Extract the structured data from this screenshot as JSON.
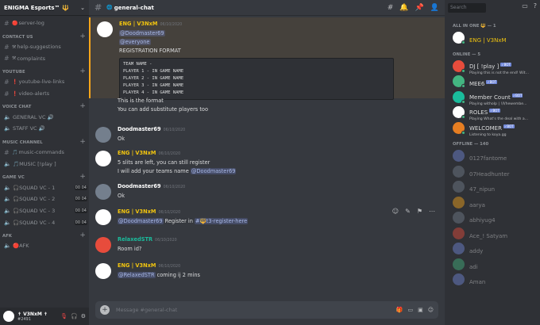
{
  "server": {
    "name": "ENIGMA Esports™ 🔱"
  },
  "sidebar": {
    "channels": [
      {
        "kind": "text",
        "emoji": "🔴",
        "label": "server-log"
      },
      {
        "kind": "cat",
        "label": "CONTACT US"
      },
      {
        "kind": "text",
        "emoji": "⚒",
        "label": "help-suggestions"
      },
      {
        "kind": "text",
        "emoji": "⚒",
        "label": "complaints"
      },
      {
        "kind": "cat",
        "label": "YOUTUBE"
      },
      {
        "kind": "text",
        "emoji": "❗",
        "label": "youtube-live-links"
      },
      {
        "kind": "text",
        "emoji": "❗",
        "label": "video-alerts"
      },
      {
        "kind": "cat",
        "label": "VOICE CHAT"
      },
      {
        "kind": "voice",
        "label": "GENERAL VC 🔊"
      },
      {
        "kind": "voice",
        "label": "STAFF VC 🔊"
      },
      {
        "kind": "cat",
        "label": "MUSIC CHANNEL"
      },
      {
        "kind": "text",
        "emoji": "🎵",
        "label": "music-commands"
      },
      {
        "kind": "voice",
        "label": "🎵MUSIC [!play ]"
      },
      {
        "kind": "cat",
        "label": "GAME VC"
      },
      {
        "kind": "voice",
        "label": "🎧SQUAD VC - 1",
        "count": "00 04"
      },
      {
        "kind": "voice",
        "label": "🎧SQUAD VC - 2",
        "count": "00 04"
      },
      {
        "kind": "voice",
        "label": "🎧SQUAD VC - 3",
        "count": "00 04"
      },
      {
        "kind": "voice",
        "label": "🎧SQUAD VC - 4",
        "count": "00 04"
      },
      {
        "kind": "cat",
        "label": "AFK"
      },
      {
        "kind": "voice",
        "label": "🔴AFK"
      }
    ]
  },
  "user": {
    "name": "✝ V3NxM ✝",
    "tag": "#2491"
  },
  "channel": {
    "name": "general-chat"
  },
  "search": {
    "placeholder": "Search"
  },
  "messages": [
    {
      "author": "ENG | V3NxM",
      "ts": "06/10/2020",
      "color": "#f1c40f",
      "av": "#ffffff",
      "highlight": true,
      "lines": [
        {
          "mention": "@Doodmaster69"
        },
        {
          "mention": "@everyone"
        },
        {
          "text": "REGISTRATION FORMAT"
        }
      ],
      "code": [
        "TEAM NAME -",
        "PLAYER 1 - IN GAME NAME",
        "PLAYER 2 - IN GAME NAME",
        "PLAYER 3 - IN GAME NAME",
        "PLAYER 4 - IN GAME NAME"
      ]
    },
    {
      "cont": true,
      "lines": [
        {
          "text": "This is the format"
        },
        {
          "text": "You can add substitute players too"
        }
      ]
    },
    {
      "author": "Doodmaster69",
      "ts": "06/10/2020",
      "color": "#ffffff",
      "av": "#747f8d",
      "lines": [
        {
          "text": "Ok"
        }
      ]
    },
    {
      "author": "ENG | V3NxM",
      "ts": "06/10/2020",
      "color": "#f1c40f",
      "av": "#ffffff",
      "lines": [
        {
          "text": "5 slits are left, you can still register"
        },
        {
          "text": "I will add your teams name ",
          "mention": "@Doodmaster69"
        }
      ]
    },
    {
      "author": "Doodmaster69",
      "ts": "06/10/2020",
      "color": "#ffffff",
      "av": "#747f8d",
      "lines": [
        {
          "text": "Ok"
        }
      ]
    },
    {
      "author": "ENG | V3NxM",
      "ts": "06/10/2020",
      "color": "#f1c40f",
      "av": "#ffffff",
      "lines": [
        {
          "mention": "@Doodmaster69",
          "text2": " Register in ",
          "mention2": "#🔱t3-register-here"
        }
      ]
    },
    {
      "author": "RelaxedSTR",
      "ts": "06/10/2020",
      "color": "#1abc9c",
      "av": "#e74c3c",
      "lines": [
        {
          "text": "Room id?"
        }
      ]
    },
    {
      "author": "ENG | V3NxM",
      "ts": "06/10/2020",
      "color": "#f1c40f",
      "av": "#ffffff",
      "lines": [
        {
          "mention": "@RelaxedSTR",
          "text2": " coming ij 2 mins"
        }
      ]
    }
  ],
  "input": {
    "placeholder": "Message #general-chat"
  },
  "members": {
    "groups": [
      {
        "label": "ALL IN ONE 🔱 — 1",
        "items": [
          {
            "name": "ENG | V3NxM",
            "color": "#f1c40f",
            "av": "#ffffff"
          }
        ]
      },
      {
        "label": "ONLINE — 5",
        "items": [
          {
            "name": "DJ [ !play ]",
            "bot": "✓BOT",
            "sub": "Playing this is not the end! Wit...",
            "color": "#dcddde",
            "av": "#e74c3c"
          },
          {
            "name": "MEE6",
            "bot": "✓BOT",
            "color": "#dcddde",
            "av": "#43b581"
          },
          {
            "name": "Member Count",
            "bot": "✓BOT",
            "sub": "Playing witholp | !/l/hewembe...",
            "color": "#dcddde",
            "av": "#1abc9c"
          },
          {
            "name": "ROLES",
            "bot": "✓BOT",
            "sub": "Playing What's the deal with a...",
            "color": "#dcddde",
            "av": "#ffffff"
          },
          {
            "name": "WELCOMER",
            "bot": "✓BOT",
            "sub": "Listening to koya.gg",
            "color": "#dcddde",
            "av": "#e67e22"
          }
        ]
      },
      {
        "label": "OFFLINE — 140",
        "offline": true,
        "items": [
          {
            "name": "0127fantome",
            "av": "#7289da"
          },
          {
            "name": "07Headhunter",
            "av": "#747f8d"
          },
          {
            "name": "47_nipun",
            "av": "#747f8d"
          },
          {
            "name": "aarya",
            "av": "#faa61a"
          },
          {
            "name": "abhiyug4",
            "av": "#747f8d"
          },
          {
            "name": "Ace_! Satyam",
            "av": "#e74c3c"
          },
          {
            "name": "addy",
            "av": "#7289da"
          },
          {
            "name": "adi",
            "av": "#43b581"
          },
          {
            "name": "Aman",
            "av": "#7289da"
          }
        ]
      }
    ]
  }
}
